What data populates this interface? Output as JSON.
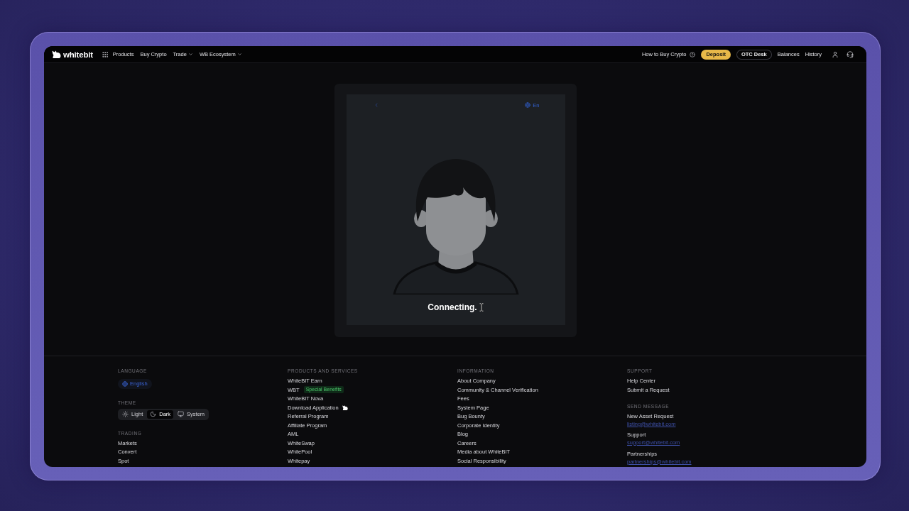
{
  "header": {
    "logo": "whitebit",
    "nav": [
      {
        "label": "Products",
        "kind": "link"
      },
      {
        "label": "Buy Crypto",
        "kind": "link"
      },
      {
        "label": "Trade",
        "kind": "dropdown"
      },
      {
        "label": "WB Ecosystem",
        "kind": "dropdown"
      }
    ],
    "actions": [
      {
        "label": "How to Buy Crypto",
        "kind": "help"
      },
      {
        "label": "Deposit",
        "kind": "primary"
      },
      {
        "label": "OTC Desk",
        "kind": "outline"
      },
      {
        "label": "Balances",
        "kind": "link"
      },
      {
        "label": "History",
        "kind": "link"
      }
    ]
  },
  "verification": {
    "language": "En",
    "status": "Connecting."
  },
  "footer": {
    "language": {
      "heading": "LANGUAGE",
      "value": "English"
    },
    "theme": {
      "heading": "THEME",
      "options": [
        {
          "label": "Light",
          "kind": "light",
          "selected": false
        },
        {
          "label": "Dark",
          "kind": "dark",
          "selected": true
        },
        {
          "label": "System",
          "kind": "system",
          "selected": false
        }
      ]
    },
    "trading": {
      "heading": "TRADING",
      "links": [
        "Markets",
        "Convert",
        "Spot"
      ]
    },
    "products": {
      "heading": "PRODUCTS AND SERVICES",
      "links": [
        {
          "label": "WhiteBIT Earn",
          "kind": "plain"
        },
        {
          "label": "WBT",
          "kind": "badge",
          "badge": "Special Benefits"
        },
        {
          "label": "WhiteBIT Nova",
          "kind": "plain"
        },
        {
          "label": "Download Application",
          "kind": "app"
        },
        {
          "label": "Referral Program",
          "kind": "plain"
        },
        {
          "label": "Affiliate Program",
          "kind": "plain"
        },
        {
          "label": "AML",
          "kind": "plain"
        },
        {
          "label": "WhiteSwap",
          "kind": "plain"
        },
        {
          "label": "WhitePool",
          "kind": "plain"
        },
        {
          "label": "Whitepay",
          "kind": "plain"
        }
      ]
    },
    "information": {
      "heading": "INFORMATION",
      "links": [
        "About Company",
        "Community & Channel Verification",
        "Fees",
        "System Page",
        "Bug Bounty",
        "Corporate Identity",
        "Blog",
        "Careers",
        "Media about WhiteBIT",
        "Social Responsibility"
      ]
    },
    "support": {
      "heading": "SUPPORT",
      "links": [
        "Help Center",
        "Submit a Request"
      ],
      "send_message": {
        "heading": "SEND MESSAGE",
        "contacts": [
          {
            "label": "New Asset Request",
            "email": "listing@whitebit.com"
          },
          {
            "label": "Support",
            "email": "support@whitebit.com"
          },
          {
            "label": "Partnerships",
            "email": "partnerships@whitebit.com"
          }
        ]
      }
    }
  }
}
